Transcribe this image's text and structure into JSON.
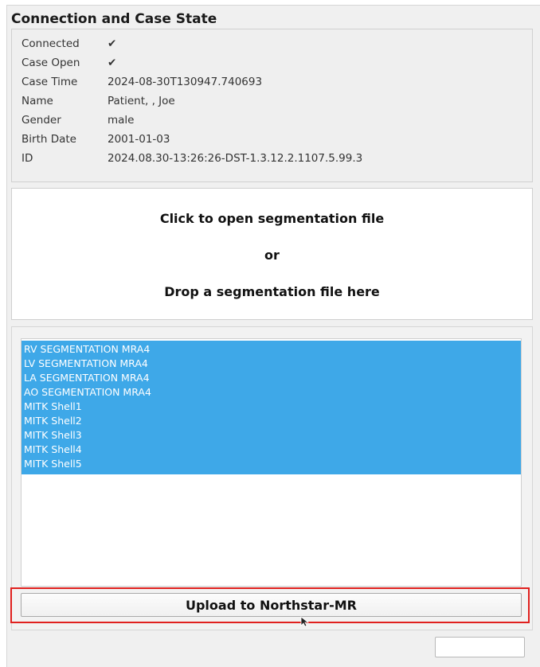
{
  "section": {
    "title": "Connection and Case State"
  },
  "info": [
    {
      "key": "Connected",
      "value": "✔"
    },
    {
      "key": "Case Open",
      "value": "✔"
    },
    {
      "key": "Case Time",
      "value": "2024-08-30T130947.740693"
    },
    {
      "key": "Name",
      "value": "Patient, , Joe"
    },
    {
      "key": "Gender",
      "value": "male"
    },
    {
      "key": "Birth Date",
      "value": "2001-01-03"
    },
    {
      "key": "ID",
      "value": "2024.08.30-13:26:26-DST-1.3.12.2.1107.5.99.3"
    }
  ],
  "dropzone": {
    "line1": "Click to open segmentation file",
    "line2": "or",
    "line3": "Drop a segmentation file here"
  },
  "segments": [
    "RV SEGMENTATION MRA4",
    "LV SEGMENTATION MRA4",
    "LA SEGMENTATION MRA4",
    "AO SEGMENTATION MRA4",
    "MITK Shell1",
    "MITK Shell2",
    "MITK Shell3",
    "MITK Shell4",
    "MITK Shell5"
  ],
  "upload": {
    "label": "Upload to Northstar-MR"
  },
  "colors": {
    "selection": "#3ea8e8",
    "highlight": "#e0201e"
  },
  "icons": {
    "cursor": "pointer-cursor-icon"
  }
}
